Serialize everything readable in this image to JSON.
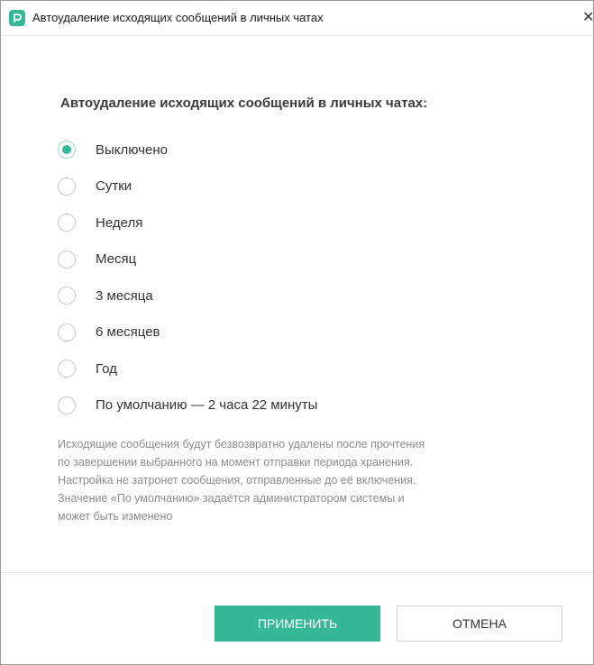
{
  "window": {
    "title": "Автоудаление исходящих сообщений в личных чатах",
    "close_glyph": "✕"
  },
  "section": {
    "title": "Автоудаление исходящих сообщений в личных чатах:"
  },
  "options": [
    {
      "label": "Выключено",
      "selected": true
    },
    {
      "label": "Сутки",
      "selected": false
    },
    {
      "label": "Неделя",
      "selected": false
    },
    {
      "label": "Месяц",
      "selected": false
    },
    {
      "label": "3 месяца",
      "selected": false
    },
    {
      "label": "6 месяцев",
      "selected": false
    },
    {
      "label": "Год",
      "selected": false
    },
    {
      "label": "По умолчанию — 2 часа 22 минуты",
      "selected": false
    }
  ],
  "hint_lines": [
    "Исходящие сообщения будут безвозвратно удалены после прочтения",
    "по завершении выбранного на момент отправки периода хранения.",
    "Настройка не затронет сообщения, отправленные до её включения.",
    "Значение «По умолчанию» задаётся администратором системы и",
    "может быть изменено"
  ],
  "buttons": {
    "apply": "ПРИМЕНИТЬ",
    "cancel": "ОТМЕНА"
  },
  "colors": {
    "accent": "#36b896",
    "hint_text": "#8c8c8c"
  },
  "icons": {
    "app": "app-logo-icon",
    "close": "close-icon"
  }
}
